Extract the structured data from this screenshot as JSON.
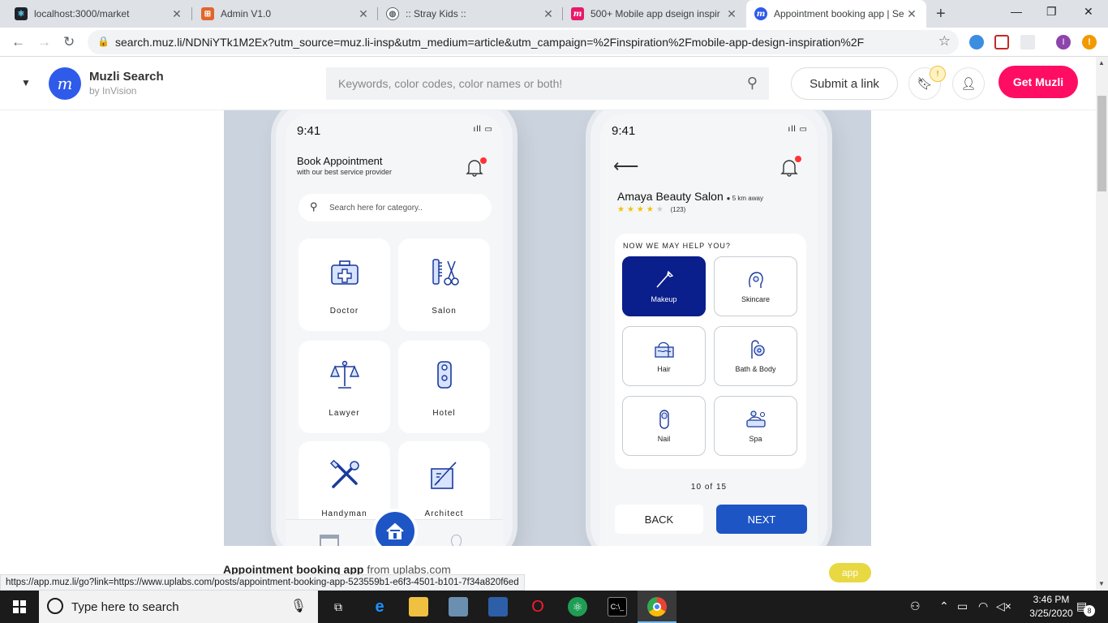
{
  "browser": {
    "tabs": [
      {
        "title": "localhost:3000/market",
        "icon": "react-icon"
      },
      {
        "title": "Admin V1.0",
        "icon": "admin-icon"
      },
      {
        "title": ":: Stray Kids ::",
        "icon": "globe-icon"
      },
      {
        "title": "500+ Mobile app dseign inspir",
        "icon": "muzli-icon"
      },
      {
        "title": "Appointment booking app | Se",
        "icon": "muzli-icon",
        "active": true
      }
    ],
    "url": "search.muz.li/NDNiYTk1M2Ex?utm_source=muz.li-insp&utm_medium=article&utm_campaign=%2Finspiration%2Fmobile-app-design-inspiration%2F",
    "profile_initial": "I"
  },
  "muzli": {
    "brand": "Muzli Search",
    "by": "by InVision",
    "logo_letter": "m",
    "search_placeholder": "Keywords, color codes, color names or both!",
    "submit_label": "Submit a link",
    "notif_badge": "!",
    "cta_label": "Get Muzli",
    "accent_color": "#ff0d63"
  },
  "phone1": {
    "time": "9:41",
    "title": "Book Appointment",
    "subtitle": "with our best service provider",
    "search_placeholder": "Search here for category..",
    "categories": [
      {
        "label": "Doctor",
        "icon": "first-aid-kit-icon"
      },
      {
        "label": "Salon",
        "icon": "comb-scissors-icon"
      },
      {
        "label": "Lawyer",
        "icon": "scales-icon"
      },
      {
        "label": "Hotel",
        "icon": "door-hanger-icon"
      },
      {
        "label": "Handyman",
        "icon": "wrench-screwdriver-icon"
      },
      {
        "label": "Architect",
        "icon": "drafting-icon"
      }
    ]
  },
  "phone2": {
    "time": "9:41",
    "salon_name": "Amaya Beauty Salon",
    "distance": "5 km away",
    "rating": 4,
    "reviews": "(123)",
    "help_title": "NOW WE MAY HELP YOU?",
    "services": [
      {
        "label": "Makeup",
        "icon": "makeup-brush-icon",
        "selected": true
      },
      {
        "label": "Skincare",
        "icon": "face-icon"
      },
      {
        "label": "Hair",
        "icon": "hair-icon"
      },
      {
        "label": "Bath & Body",
        "icon": "shower-icon"
      },
      {
        "label": "Nail",
        "icon": "nail-icon"
      },
      {
        "label": "Spa",
        "icon": "spa-icon"
      }
    ],
    "pager": "10 of 15",
    "back_label": "BACK",
    "next_label": "NEXT"
  },
  "caption": {
    "title": "Appointment booking app",
    "source": "from uplabs.com",
    "tag": "app"
  },
  "status_url": "https://app.muz.li/go?link=https://www.uplabs.com/posts/appointment-booking-app-523559b1-e6f3-4501-b101-7f34a820f6ed",
  "taskbar": {
    "search_placeholder": "Type here to search",
    "time": "3:46 PM",
    "date": "3/25/2020",
    "notif_count": "8"
  }
}
